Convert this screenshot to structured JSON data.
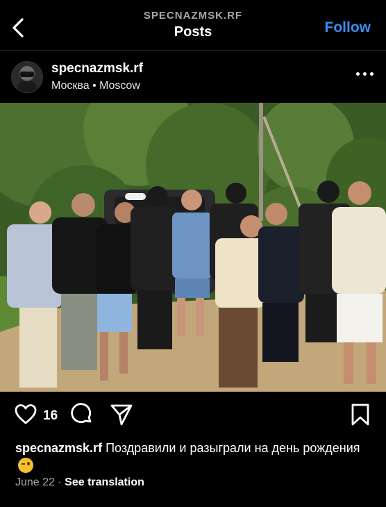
{
  "nav": {
    "account_caps": "SPECNAZMSK.RF",
    "title": "Posts",
    "follow_label": "Follow",
    "back_icon": "chevron-left-icon"
  },
  "post": {
    "username": "specnazmsk.rf",
    "location": "Москва • Moscow",
    "more_icon": "more-horizontal-icon",
    "photo_alt": "Group photo outdoors"
  },
  "actions": {
    "like_icon": "heart-outline-icon",
    "like_count": "16",
    "comment_icon": "comment-icon",
    "share_icon": "send-icon",
    "save_icon": "bookmark-icon"
  },
  "caption": {
    "username": "specnazmsk.rf",
    "text": "Поздравили и разыграли на день рождения",
    "emoji": "winking-face"
  },
  "meta": {
    "date": "June 22",
    "separator": "·",
    "translate_label": "See translation"
  },
  "colors": {
    "background": "#000000",
    "accent": "#3d8cf2",
    "secondary_text": "#a8a8a8"
  }
}
